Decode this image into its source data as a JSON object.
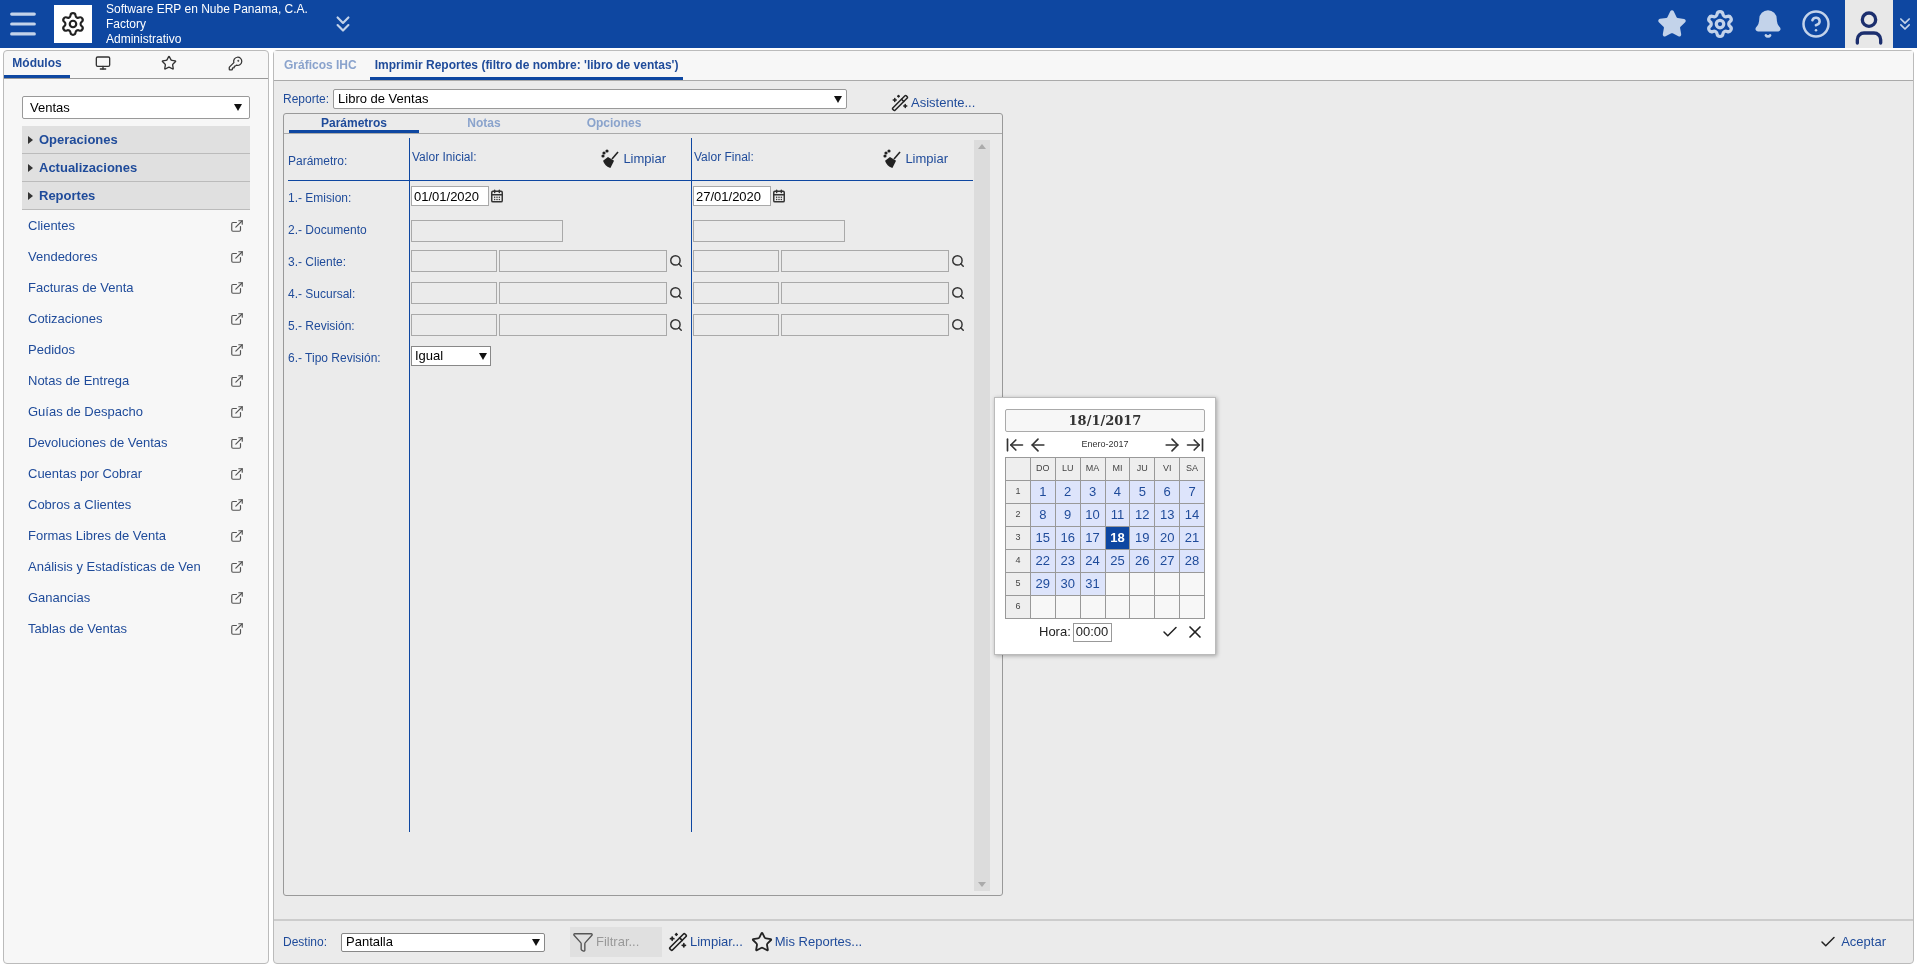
{
  "header": {
    "company": "Software ERP en Nube Panama, C.A.",
    "site": "Factory",
    "role": "Administrativo"
  },
  "sidebar": {
    "tabs": [
      {
        "kind": "text",
        "label": "Módulos",
        "selected": true
      },
      {
        "kind": "monitor",
        "selected": false
      },
      {
        "kind": "star",
        "selected": false
      },
      {
        "kind": "key",
        "selected": false
      }
    ],
    "module": "Ventas",
    "sections": [
      {
        "label": "Operaciones",
        "expanded": false
      },
      {
        "label": "Actualizaciones",
        "expanded": false
      },
      {
        "label": "Reportes",
        "expanded": false
      }
    ],
    "items": [
      "Clientes",
      "Vendedores",
      "Facturas de Venta",
      "Cotizaciones",
      "Pedidos",
      "Notas de Entrega",
      "Guías de Despacho",
      "Devoluciones de Ventas",
      "Cuentas por Cobrar",
      "Cobros a Clientes",
      "Formas Libres de Venta",
      "Análisis y Estadísticas de Ven",
      "Ganancias",
      "Tablas de Ventas"
    ]
  },
  "main": {
    "tabs": [
      {
        "label": "Gráficos IHC",
        "selected": false
      },
      {
        "label": "Imprimir Reportes (filtro de nombre: 'libro de ventas')",
        "selected": true
      }
    ],
    "report_label": "Reporte:",
    "report": "Libro de Ventas",
    "assistant": "Asistente...",
    "inner_tabs": [
      {
        "label": "Parámetros",
        "selected": true
      },
      {
        "label": "Notas",
        "selected": false
      },
      {
        "label": "Opciones",
        "selected": false
      }
    ],
    "params": {
      "param_heading": "Parámetro:",
      "initial_heading": "Valor Inicial:",
      "final_heading": "Valor Final:",
      "clear_initial": "Limpiar",
      "clear_final": "Limpiar",
      "rows": [
        {
          "label": "1.- Emision:",
          "kind": "date",
          "initial": "01/01/2020",
          "final": "27/01/2020"
        },
        {
          "label": "2.- Documento",
          "kind": "text"
        },
        {
          "label": "3.- Cliente:",
          "kind": "lookup"
        },
        {
          "label": "4.- Sucursal:",
          "kind": "lookup"
        },
        {
          "label": "5.- Revisión:",
          "kind": "lookup"
        },
        {
          "label": "6.- Tipo Revisión:",
          "kind": "select",
          "initial": "Igual"
        }
      ]
    },
    "bottom": {
      "destination_label": "Destino:",
      "destination": "Pantalla",
      "filter": {
        "label": "Filtrar...",
        "disabled": true
      },
      "clear": "Limpiar...",
      "my_reports": "Mis Reportes...",
      "accept": "Aceptar"
    }
  },
  "calendar": {
    "title": "18/1/2017",
    "month": "Enero-2017",
    "weekdays": [
      "DO",
      "LU",
      "MA",
      "MI",
      "JU",
      "VI",
      "SA"
    ],
    "weeks": [
      {
        "number": "1",
        "days": [
          {
            "label": "1",
            "selected": false
          },
          {
            "label": "2",
            "selected": false
          },
          {
            "label": "3",
            "selected": false
          },
          {
            "label": "4",
            "selected": false
          },
          {
            "label": "5",
            "selected": false
          },
          {
            "label": "6",
            "selected": false
          },
          {
            "label": "7",
            "selected": false
          }
        ]
      },
      {
        "number": "2",
        "days": [
          {
            "label": "8",
            "selected": false
          },
          {
            "label": "9",
            "selected": false
          },
          {
            "label": "10",
            "selected": false
          },
          {
            "label": "11",
            "selected": false
          },
          {
            "label": "12",
            "selected": false
          },
          {
            "label": "13",
            "selected": false
          },
          {
            "label": "14",
            "selected": false
          }
        ]
      },
      {
        "number": "3",
        "days": [
          {
            "label": "15",
            "selected": false
          },
          {
            "label": "16",
            "selected": false
          },
          {
            "label": "17",
            "selected": false
          },
          {
            "label": "18",
            "selected": true
          },
          {
            "label": "19",
            "selected": false
          },
          {
            "label": "20",
            "selected": false
          },
          {
            "label": "21",
            "selected": false
          }
        ]
      },
      {
        "number": "4",
        "days": [
          {
            "label": "22",
            "selected": false
          },
          {
            "label": "23",
            "selected": false
          },
          {
            "label": "24",
            "selected": false
          },
          {
            "label": "25",
            "selected": false
          },
          {
            "label": "26",
            "selected": false
          },
          {
            "label": "27",
            "selected": false
          },
          {
            "label": "28",
            "selected": false
          }
        ]
      },
      {
        "number": "5",
        "days": [
          {
            "label": "29",
            "selected": false
          },
          {
            "label": "30",
            "selected": false
          },
          {
            "label": "31",
            "selected": false
          }
        ]
      },
      {
        "number": "6"
      }
    ],
    "hour_label": "Hora:",
    "hour": "00:00"
  }
}
